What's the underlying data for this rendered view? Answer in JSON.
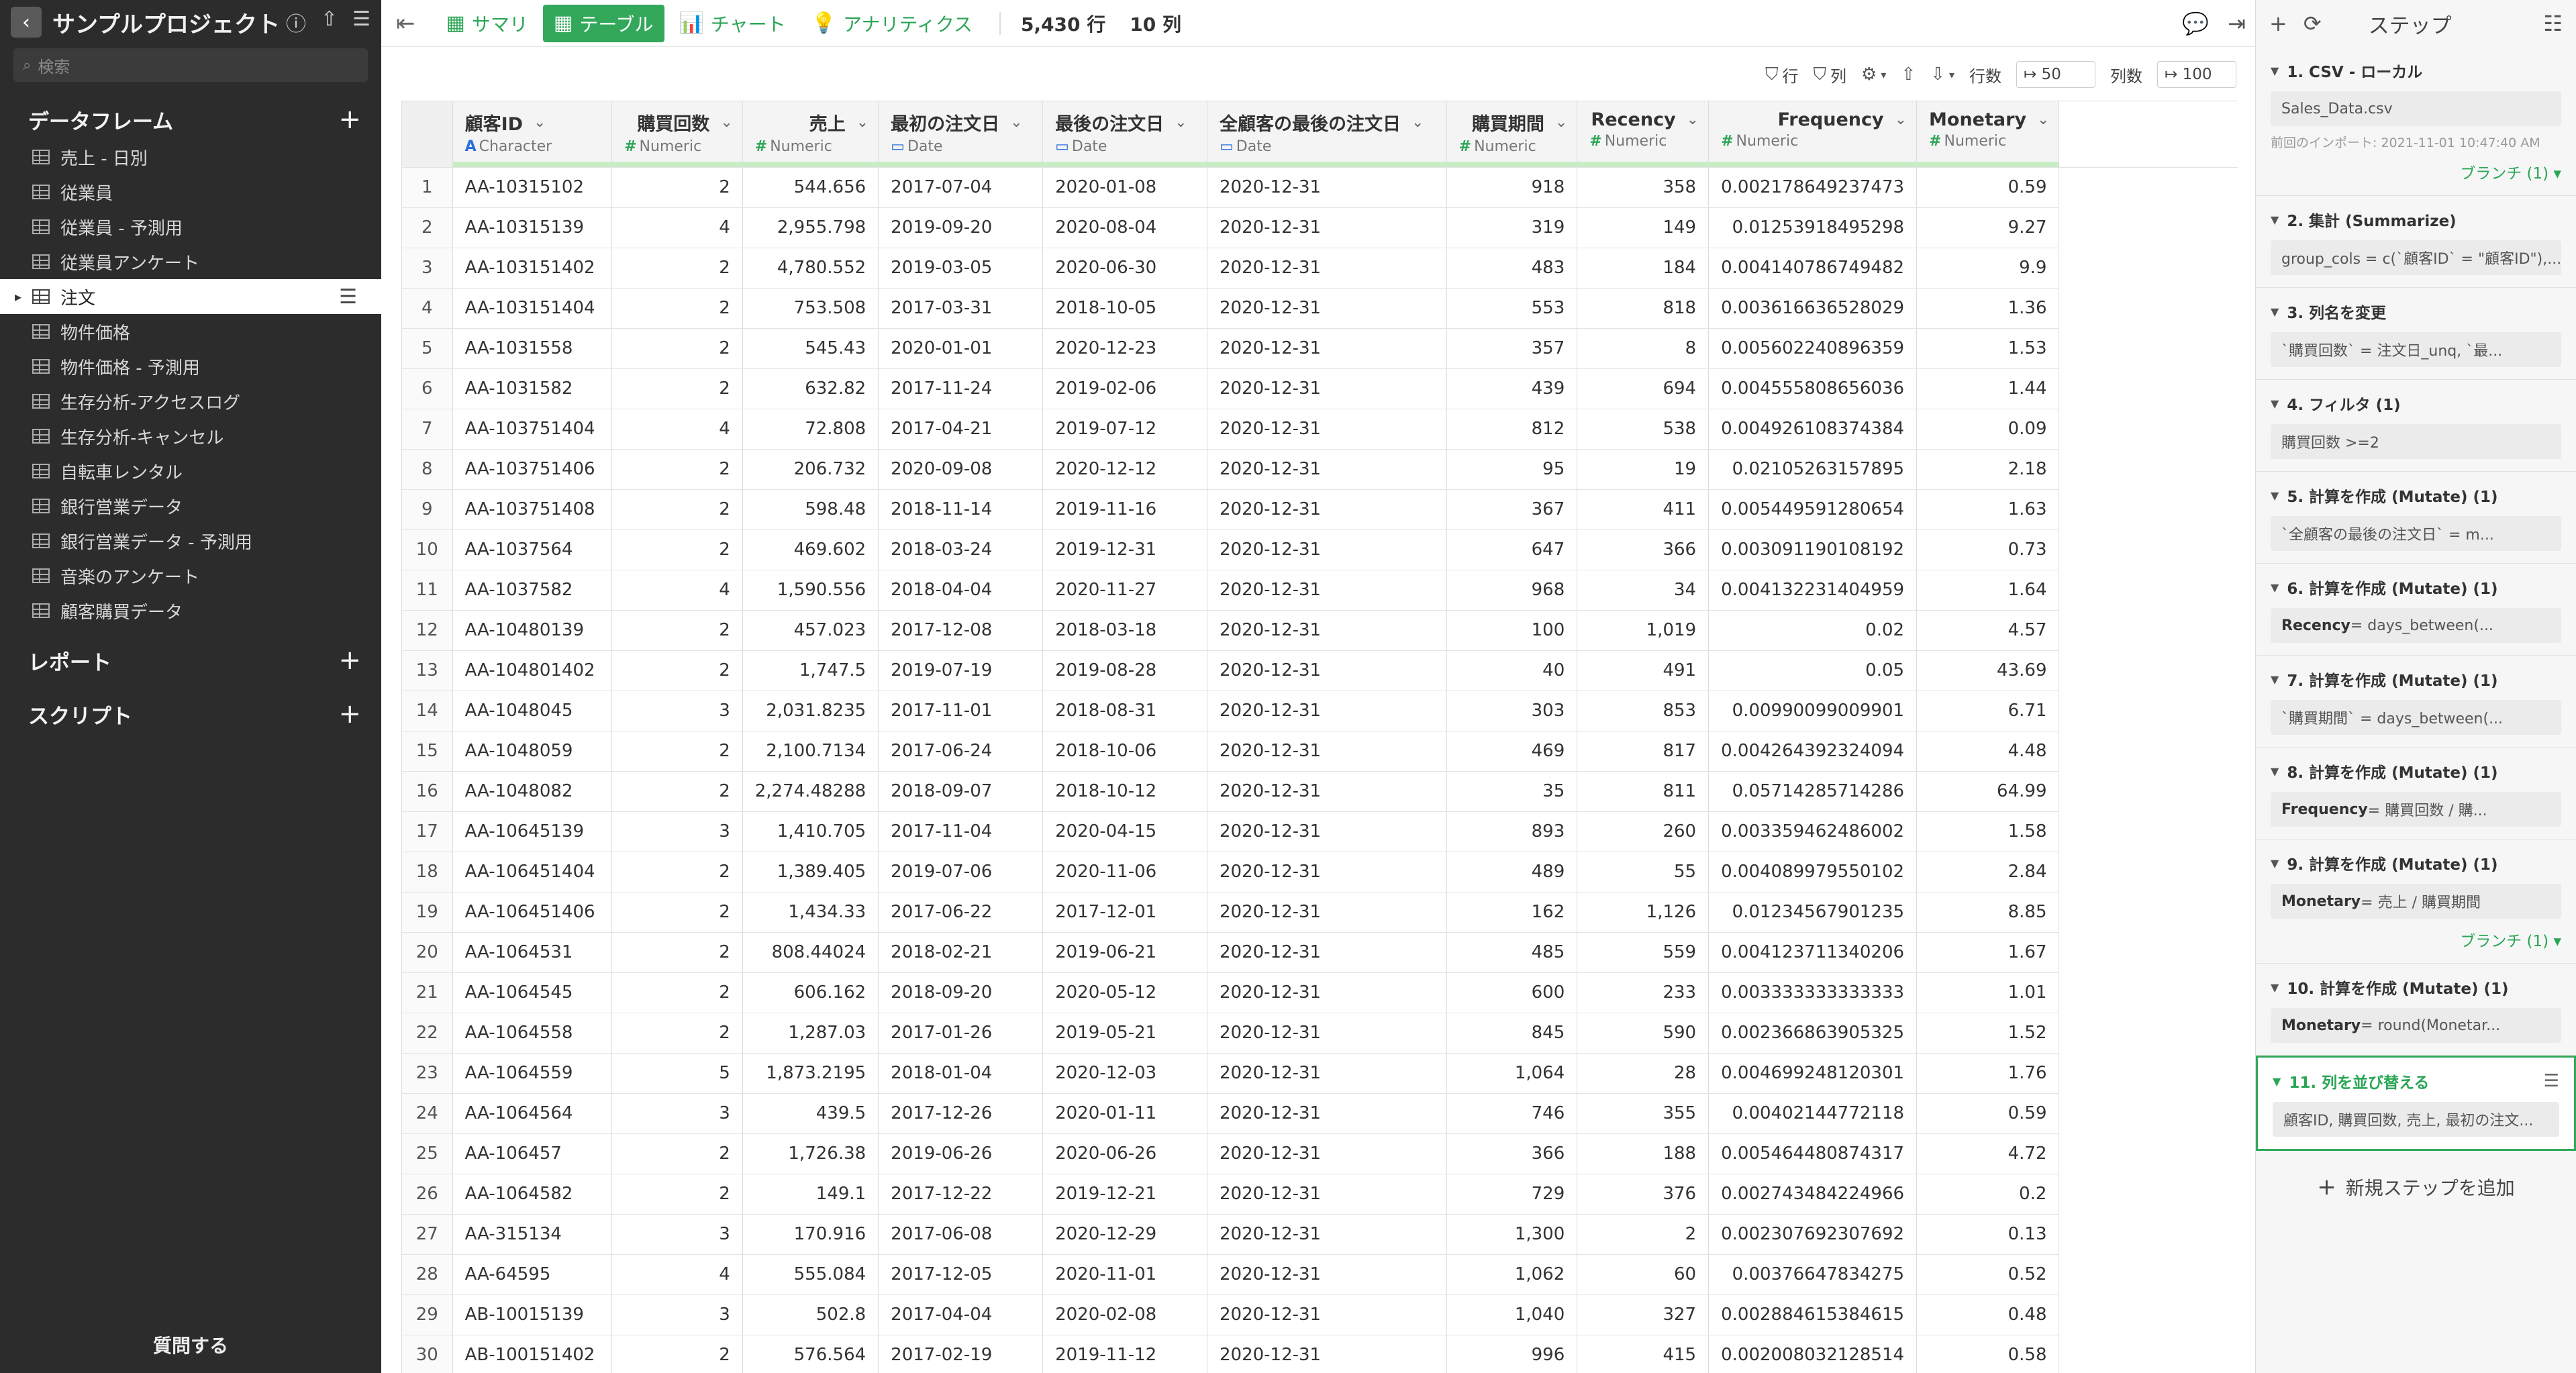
{
  "project": {
    "title": "サンプルプロジェクト"
  },
  "search": {
    "placeholder": "検索"
  },
  "sidebar": {
    "dataframes_heading": "データフレーム",
    "dataframes": [
      "売上 - 日別",
      "従業員",
      "従業員 - 予測用",
      "従業員アンケート",
      "注文",
      "物件価格",
      "物件価格 - 予測用",
      "生存分析-アクセスログ",
      "生存分析-キャンセル",
      "自転車レンタル",
      "銀行営業データ",
      "銀行営業データ - 予測用",
      "音楽のアンケート",
      "顧客購買データ"
    ],
    "active_index": 4,
    "reports_heading": "レポート",
    "scripts_heading": "スクリプト",
    "ask_label": "質問する"
  },
  "toolbar": {
    "tabs": [
      {
        "label": "サマリ",
        "icon": "table-icon"
      },
      {
        "label": "テーブル",
        "icon": "table-icon"
      },
      {
        "label": "チャート",
        "icon": "chart-icon"
      },
      {
        "label": "アナリティクス",
        "icon": "bulb-icon"
      }
    ],
    "active_tab": 1,
    "rows_count": "5,430 行",
    "cols_count": "10 列"
  },
  "subbar": {
    "row_label": "行",
    "col_label": "列",
    "rows_per_page_label": "行数",
    "rows_per_page_value": "↦ 50",
    "cols_per_page_label": "列数",
    "cols_per_page_value": "↦ 100"
  },
  "table": {
    "columns": [
      {
        "name": "顧客ID",
        "type": "Character",
        "align": "left"
      },
      {
        "name": "購買回数",
        "type": "Numeric",
        "align": "right"
      },
      {
        "name": "売上",
        "type": "Numeric",
        "align": "right"
      },
      {
        "name": "最初の注文日",
        "type": "Date",
        "align": "left"
      },
      {
        "name": "最後の注文日",
        "type": "Date",
        "align": "left"
      },
      {
        "name": "全顧客の最後の注文日",
        "type": "Date",
        "align": "left"
      },
      {
        "name": "購買期間",
        "type": "Numeric",
        "align": "right"
      },
      {
        "name": "Recency",
        "type": "Numeric",
        "align": "right"
      },
      {
        "name": "Frequency",
        "type": "Numeric",
        "align": "right"
      },
      {
        "name": "Monetary",
        "type": "Numeric",
        "align": "right"
      }
    ],
    "rows": [
      [
        "1",
        "AA-10315102",
        "2",
        "544.656",
        "2017-07-04",
        "2020-01-08",
        "2020-12-31",
        "918",
        "358",
        "0.00217864923747 3",
        "0.59"
      ],
      [
        "2",
        "AA-10315139",
        "4",
        "2,955.798",
        "2019-09-20",
        "2020-08-04",
        "2020-12-31",
        "319",
        "149",
        "0.01253918495298",
        "9.27"
      ],
      [
        "3",
        "AA-103151402",
        "2",
        "4,780.552",
        "2019-03-05",
        "2020-06-30",
        "2020-12-31",
        "483",
        "184",
        "0.00414078674948 2",
        "9.9"
      ],
      [
        "4",
        "AA-103151404",
        "2",
        "753.508",
        "2017-03-31",
        "2018-10-05",
        "2020-12-31",
        "553",
        "818",
        "0.00361663652802 9",
        "1.36"
      ],
      [
        "5",
        "AA-1031558",
        "2",
        "545.43",
        "2020-01-01",
        "2020-12-23",
        "2020-12-31",
        "357",
        "8",
        "0.00560224089635 9",
        "1.53"
      ],
      [
        "6",
        "AA-1031582",
        "2",
        "632.82",
        "2017-11-24",
        "2019-02-06",
        "2020-12-31",
        "439",
        "694",
        "0.00455580865603 6",
        "1.44"
      ],
      [
        "7",
        "AA-103751404",
        "4",
        "72.808",
        "2017-04-21",
        "2019-07-12",
        "2020-12-31",
        "812",
        "538",
        "0.00492610837438 4",
        "0.09"
      ],
      [
        "8",
        "AA-103751406",
        "2",
        "206.732",
        "2020-09-08",
        "2020-12-12",
        "2020-12-31",
        "95",
        "19",
        "0.02105263157895",
        "2.18"
      ],
      [
        "9",
        "AA-103751408",
        "2",
        "598.48",
        "2018-11-14",
        "2019-11-16",
        "2020-12-31",
        "367",
        "411",
        "0.00544959128065 4",
        "1.63"
      ],
      [
        "10",
        "AA-1037564",
        "2",
        "469.602",
        "2018-03-24",
        "2019-12-31",
        "2020-12-31",
        "647",
        "366",
        "0.00309119010819 2",
        "0.73"
      ],
      [
        "11",
        "AA-1037582",
        "4",
        "1,590.556",
        "2018-04-04",
        "2020-11-27",
        "2020-12-31",
        "968",
        "34",
        "0.00413223140495 9",
        "1.64"
      ],
      [
        "12",
        "AA-10480139",
        "2",
        "457.023",
        "2017-12-08",
        "2018-03-18",
        "2020-12-31",
        "100",
        "1,019",
        "0.02",
        "4.57"
      ],
      [
        "13",
        "AA-104801402",
        "2",
        "1,747.5",
        "2019-07-19",
        "2019-08-28",
        "2020-12-31",
        "40",
        "491",
        "0.05",
        "43.69"
      ],
      [
        "14",
        "AA-1048045",
        "3",
        "2,031.8235",
        "2017-11-01",
        "2018-08-31",
        "2020-12-31",
        "303",
        "853",
        "0.00990099009901",
        "6.71"
      ],
      [
        "15",
        "AA-1048059",
        "2",
        "2,100.7134",
        "2017-06-24",
        "2018-10-06",
        "2020-12-31",
        "469",
        "817",
        "0.00426439232409 4",
        "4.48"
      ],
      [
        "16",
        "AA-1048082",
        "2",
        "2,274.48288",
        "2018-09-07",
        "2018-10-12",
        "2020-12-31",
        "35",
        "811",
        "0.05714285714286",
        "64.99"
      ],
      [
        "17",
        "AA-10645139",
        "3",
        "1,410.705",
        "2017-11-04",
        "2020-04-15",
        "2020-12-31",
        "893",
        "260",
        "0.00335946248600 2",
        "1.58"
      ],
      [
        "18",
        "AA-106451404",
        "2",
        "1,389.405",
        "2019-07-06",
        "2020-11-06",
        "2020-12-31",
        "489",
        "55",
        "0.00408997955010 2",
        "2.84"
      ],
      [
        "19",
        "AA-106451406",
        "2",
        "1,434.33",
        "2017-06-22",
        "2017-12-01",
        "2020-12-31",
        "162",
        "1,126",
        "0.01234567901235",
        "8.85"
      ],
      [
        "20",
        "AA-1064531",
        "2",
        "808.44024",
        "2018-02-21",
        "2019-06-21",
        "2020-12-31",
        "485",
        "559",
        "0.00412371134020 6",
        "1.67"
      ],
      [
        "21",
        "AA-1064545",
        "2",
        "606.162",
        "2018-09-20",
        "2020-05-12",
        "2020-12-31",
        "600",
        "233",
        "0.00333333333333 3",
        "1.01"
      ],
      [
        "22",
        "AA-1064558",
        "2",
        "1,287.03",
        "2017-01-26",
        "2019-05-21",
        "2020-12-31",
        "845",
        "590",
        "0.00236686390532 5",
        "1.52"
      ],
      [
        "23",
        "AA-1064559",
        "5",
        "1,873.2195",
        "2018-01-04",
        "2020-12-03",
        "2020-12-31",
        "1,064",
        "28",
        "0.00469924812030 1",
        "1.76"
      ],
      [
        "24",
        "AA-1064564",
        "3",
        "439.5",
        "2017-12-26",
        "2020-01-11",
        "2020-12-31",
        "746",
        "355",
        "0.00402144772118",
        "0.59"
      ],
      [
        "25",
        "AA-106457",
        "2",
        "1,726.38",
        "2019-06-26",
        "2020-06-26",
        "2020-12-31",
        "366",
        "188",
        "0.00546448087431 7",
        "4.72"
      ],
      [
        "26",
        "AA-1064582",
        "2",
        "149.1",
        "2017-12-22",
        "2019-12-21",
        "2020-12-31",
        "729",
        "376",
        "0.00274348422496 6",
        "0.2"
      ],
      [
        "27",
        "AA-315134",
        "3",
        "170.916",
        "2017-06-08",
        "2020-12-29",
        "2020-12-31",
        "1,300",
        "2",
        "0.00230769230769 2",
        "0.13"
      ],
      [
        "28",
        "AA-64595",
        "4",
        "555.084",
        "2017-12-05",
        "2020-11-01",
        "2020-12-31",
        "1,062",
        "60",
        "0.00376647834275",
        "0.52"
      ],
      [
        "29",
        "AB-10015139",
        "3",
        "502.8",
        "2017-04-04",
        "2020-02-08",
        "2020-12-31",
        "1,040",
        "327",
        "0.00288461538461 5",
        "0.48"
      ],
      [
        "30",
        "AB-100151402",
        "2",
        "576.564",
        "2017-02-19",
        "2019-11-12",
        "2020-12-31",
        "996",
        "415",
        "0.00200803212851 4",
        "0.58"
      ]
    ]
  },
  "steps_panel": {
    "title": "ステップ",
    "steps": [
      {
        "title": "1. CSV - ローカル",
        "body": "Sales_Data.csv",
        "meta": "前回のインポート: 2021-11-01 10:47:40 AM",
        "branch": "ブランチ (1) ▾"
      },
      {
        "title": "2. 集計 (Summarize)",
        "body": "group_cols = c(`顧客ID` = \"顧客ID\"),..."
      },
      {
        "title": "3. 列名を変更",
        "body": "`購買回数` = 注文日_unq, `最..."
      },
      {
        "title": "4. フィルタ (1)",
        "body": "購買回数 >= 2"
      },
      {
        "title": "5. 計算を作成 (Mutate) (1)",
        "body": "`全顧客の最後の注文日` = m..."
      },
      {
        "title": "6. 計算を作成 (Mutate) (1)",
        "body_bold": "Recency",
        "body": " = days_between(..."
      },
      {
        "title": "7. 計算を作成 (Mutate) (1)",
        "body": "`購買期間` = days_between(..."
      },
      {
        "title": "8. 計算を作成 (Mutate) (1)",
        "body_bold": "Frequency",
        "body": " = 購買回数 / 購..."
      },
      {
        "title": "9. 計算を作成 (Mutate) (1)",
        "body_bold": "Monetary",
        "body": " = 売上 / 購買期間",
        "branch": "ブランチ (1) ▾"
      },
      {
        "title": "10. 計算を作成 (Mutate) (1)",
        "body_bold": "Monetary",
        "body": " = round(Monetar..."
      },
      {
        "title": "11. 列を並び替える",
        "body": "顧客ID, 購買回数, 売上, 最初の注文...",
        "active": true
      }
    ],
    "add_step_label": "新規ステップを追加"
  }
}
